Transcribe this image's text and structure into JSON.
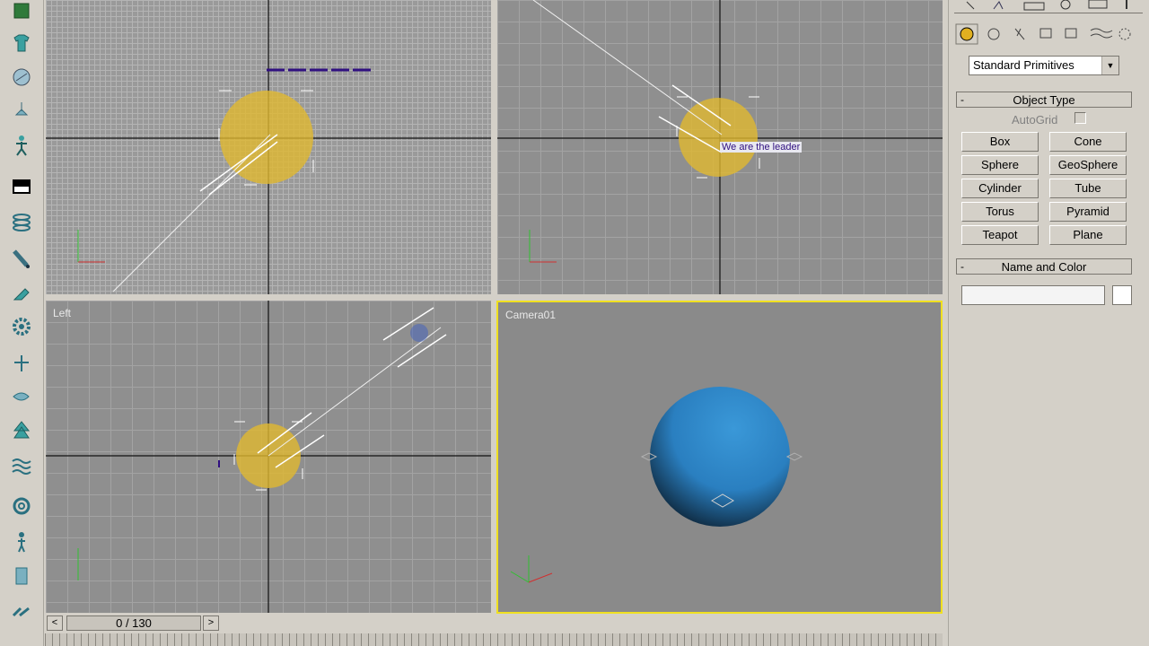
{
  "viewports": {
    "left_label": "Left",
    "camera_label": "Camera01",
    "front_annotation": "We are the leader"
  },
  "command_panel": {
    "tab_icons": [
      "create-icon",
      "modify-icon",
      "hierarchy-icon",
      "motion-icon",
      "display-icon",
      "utilities-icon"
    ],
    "category_icons": [
      "geometry-icon",
      "shapes-icon",
      "lights-icon",
      "cameras-icon",
      "helpers-icon",
      "space-warps-icon",
      "systems-icon"
    ],
    "dropdown_value": "Standard Primitives",
    "object_type": {
      "title": "Object Type",
      "autogrid_label": "AutoGrid",
      "buttons": [
        "Box",
        "Cone",
        "Sphere",
        "GeoSphere",
        "Cylinder",
        "Tube",
        "Torus",
        "Pyramid",
        "Teapot",
        "Plane"
      ]
    },
    "name_color": {
      "title": "Name and Color",
      "name_value": ""
    },
    "collapse_symbol": "-"
  },
  "timeline": {
    "frame_display": "0 / 130",
    "prev_symbol": "<",
    "next_symbol": ">"
  },
  "colors": {
    "selection_yellow": "#f0e020",
    "sphere_blue": "#2a7fc0",
    "light_glow": "#e0b830",
    "viewport_bg": "#8c8c8c"
  }
}
